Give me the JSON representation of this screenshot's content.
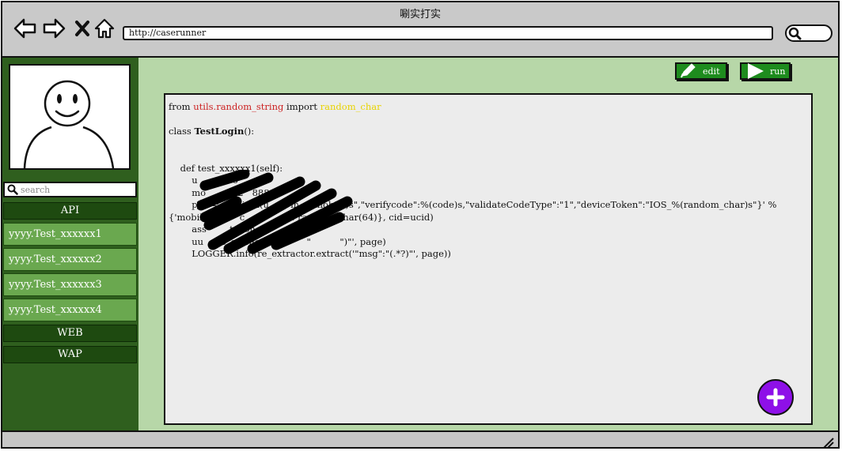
{
  "window": {
    "title": "唰实打实"
  },
  "toolbar": {
    "url": "http://caserunner",
    "back_icon": "arrow-left-icon",
    "forward_icon": "arrow-right-icon",
    "close_icon": "close-icon",
    "home_icon": "home-icon"
  },
  "sidebar": {
    "search_placeholder": "search",
    "categories": {
      "api": "API",
      "web": "WEB",
      "wap": "WAP"
    },
    "items": [
      "yyyy.Test_xxxxxx1",
      "yyyy.Test_xxxxxx2",
      "yyyy.Test_xxxxxx3",
      "yyyy.Test_xxxxxx4"
    ]
  },
  "main": {
    "edit_label": "edit",
    "run_label": "run",
    "code": {
      "l1_from": "from ",
      "l1_module": "utils.random_string",
      "l1_import": " import ",
      "l1_name": "random_char",
      "l2_class": "class ",
      "l2_name": "TestLogin",
      "l2_rest": "():",
      "l3": "    def test_xxxxxx1(self):",
      "l4": "        u          36'",
      "l5": "        mo         02   888",
      "l6": "        pa   = a   pi   n(u    {\"m    (mobile)s\",\"verifycode\":%(code)s,\"validateCodeType\":\"1\",\"deviceToken\":\"IOS_%(random_char)s\"}' %",
      "l7": "{'mobile':         c            ar': random_char(64)}, cid=ucid)",
      "l8": "        ass        t None",
      "l9": "        uu      e_extractor.ext      \"          \")\"', page)",
      "l10": "        LOGGER.info(re_extractor.extract('\"msg\":\"(.*?)\"', page))"
    }
  },
  "colors": {
    "accent": "#6aa84f",
    "sidebar": "#2f5f1e",
    "fab": "#8e10e8",
    "main_bg": "#b7d7a8"
  }
}
